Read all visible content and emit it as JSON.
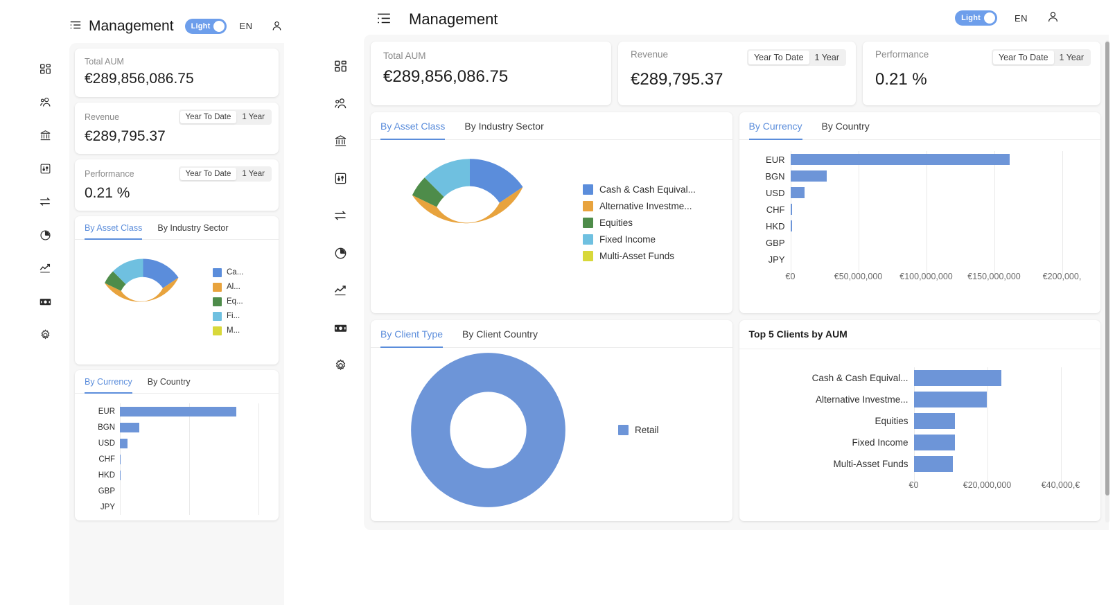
{
  "app": {
    "title": "Management",
    "theme_toggle_label": "Light",
    "language": "EN"
  },
  "kpis": [
    {
      "label": "Total AUM",
      "value": "€289,856,086.75",
      "has_range": false
    },
    {
      "label": "Revenue",
      "value": "€289,795.37",
      "has_range": true
    },
    {
      "label": "Performance",
      "value": "0.21 %",
      "has_range": true
    }
  ],
  "range_options": [
    "Year To Date",
    "1 Year"
  ],
  "range_selected": "Year To Date",
  "cards": {
    "allocation": {
      "tabs": [
        "By Asset Class",
        "By Industry Sector"
      ],
      "active_tab": "By Asset Class",
      "legend_short": [
        "Ca...",
        "Al...",
        "Eq...",
        "Fi...",
        "M..."
      ]
    },
    "currency": {
      "tabs": [
        "By Currency",
        "By Country"
      ],
      "active_tab": "By Currency"
    },
    "clienttype": {
      "tabs": [
        "By Client Type",
        "By Client Country"
      ],
      "active_tab": "By Client Type"
    },
    "topclients": {
      "title": "Top 5 Clients by AUM"
    }
  },
  "sidebar": {
    "items": [
      {
        "name": "dashboard",
        "icon": "grid-icon"
      },
      {
        "name": "clients",
        "icon": "users-icon"
      },
      {
        "name": "institutions",
        "icon": "bank-icon"
      },
      {
        "name": "parameters",
        "icon": "sliders-icon"
      },
      {
        "name": "transactions",
        "icon": "transfer-icon"
      },
      {
        "name": "allocation",
        "icon": "pie-chart-icon"
      },
      {
        "name": "performance",
        "icon": "trending-up-icon"
      },
      {
        "name": "revenue",
        "icon": "cash-icon"
      },
      {
        "name": "settings",
        "icon": "gear-icon"
      }
    ]
  },
  "colors": {
    "accent": "#5b8ddb",
    "bar": "#6d95d8",
    "series": [
      "#5b8ddb",
      "#e8a33d",
      "#4e8c4a",
      "#6fc0e0",
      "#d8d83a"
    ]
  },
  "chart_data": [
    {
      "id": "allocation-donut",
      "type": "pie",
      "title": "By Asset Class",
      "legend_position": "right",
      "categories": [
        "Cash & Cash Equival...",
        "Alternative Investme...",
        "Equities",
        "Fixed Income",
        "Multi-Asset Funds"
      ],
      "values": [
        17,
        68,
        8,
        7,
        0
      ],
      "colors": [
        "#5b8ddb",
        "#e8a33d",
        "#4e8c4a",
        "#6fc0e0",
        "#d8d83a"
      ]
    },
    {
      "id": "currency-bars",
      "type": "bar",
      "title": "By Currency",
      "orientation": "horizontal",
      "categories": [
        "EUR",
        "BGN",
        "USD",
        "CHF",
        "HKD",
        "GBP",
        "JPY"
      ],
      "values": [
        158000000,
        26000000,
        10000000,
        400000,
        400000,
        0,
        0
      ],
      "xlabel": "",
      "ylabel": "",
      "xlim": [
        0,
        200000000
      ],
      "xticks": [
        0,
        50000000,
        100000000,
        150000000,
        200000000
      ],
      "xticklabels": [
        "€0",
        "€50,000,000",
        "€100,000,000",
        "€150,000,000",
        "€200,000,"
      ],
      "grid": true
    },
    {
      "id": "clienttype-donut",
      "type": "pie",
      "title": "By Client Type",
      "legend_position": "right",
      "categories": [
        "Retail"
      ],
      "values": [
        100
      ],
      "colors": [
        "#6d95d8"
      ]
    },
    {
      "id": "topclients-bars",
      "type": "bar",
      "title": "Top 5 Clients by AUM",
      "orientation": "horizontal",
      "categories": [
        "Cash & Cash Equival...",
        "Alternative Investme...",
        "Equities",
        "Fixed Income",
        "Multi-Asset Funds"
      ],
      "values": [
        24500000,
        21500000,
        11500000,
        11200000,
        10800000
      ],
      "xlabel": "",
      "ylabel": "",
      "xlim": [
        0,
        42000000
      ],
      "xticks": [
        0,
        20000000,
        40000000
      ],
      "xticklabels": [
        "€0",
        "€20,000,000",
        "€40,000,€"
      ],
      "grid": true
    }
  ]
}
